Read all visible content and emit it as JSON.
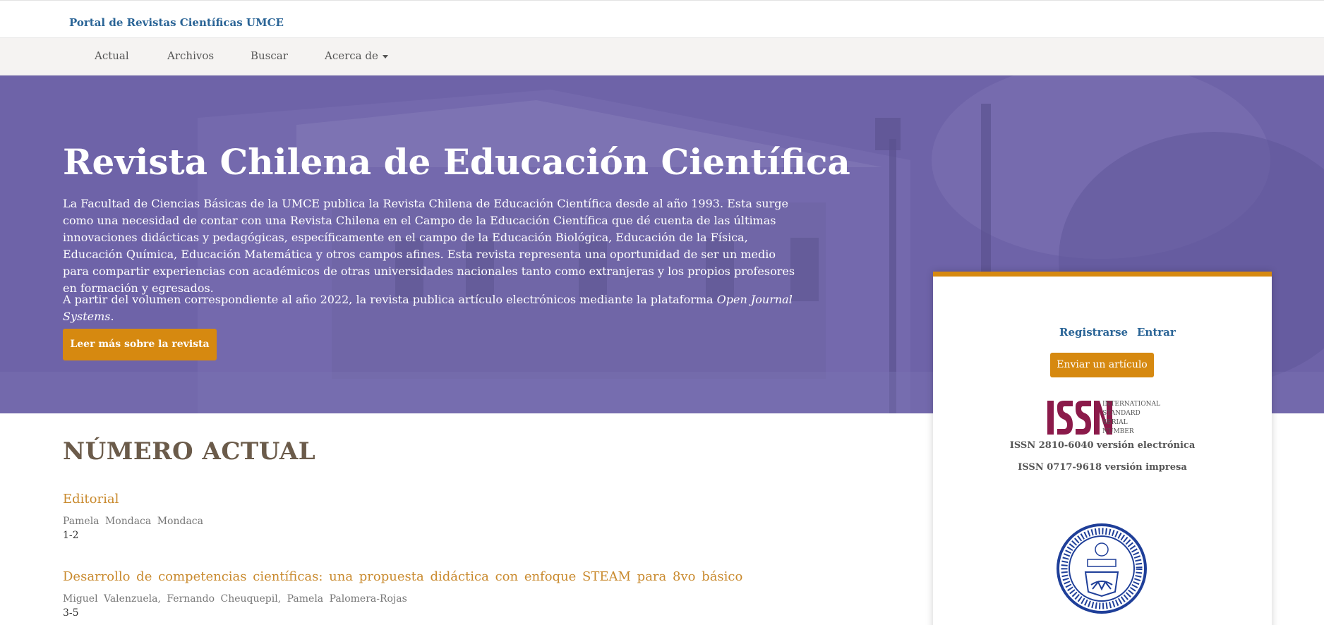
{
  "header": {
    "site_name": "Portal de Revistas Científicas UMCE"
  },
  "nav": {
    "items": [
      {
        "label": "Actual"
      },
      {
        "label": "Archivos"
      },
      {
        "label": "Buscar"
      },
      {
        "label": "Acerca de"
      }
    ]
  },
  "hero": {
    "title": "Revista Chilena de Educación Científica",
    "paragraph1": "La Facultad de Ciencias Básicas de la UMCE publica la Revista Chilena de Educación Científica desde al año 1993. Esta surge como una necesidad de contar con una Revista Chilena en el Campo de la Educación Científica que dé cuenta de las últimas innovaciones didácticas y pedagógicas, específicamente en el campo de la Educación Biológica, Educación de la Física, Educación Química, Educación Matemática y otros campos afines. Esta revista representa una oportunidad de ser un medio para compartir experiencias con académicos de otras universidades nacionales tanto como extranjeras y los propios profesores en formación y egresados.",
    "paragraph2_prefix": "A partir del volumen correspondiente al año 2022, la revista publica artículo electrónicos mediante la plataforma ",
    "paragraph2_platform": "Open Journal Systems",
    "paragraph2_suffix": ".",
    "button_label": "Leer más sobre la revista"
  },
  "sidebar": {
    "register_label": "Registrarse",
    "login_label": "Entrar",
    "submit_label": "Enviar un artículo",
    "issn_logo_text": [
      "INTERNATIONAL",
      "STANDARD",
      "SERIAL",
      "NUMBER"
    ],
    "issn_electronic": "ISSN 2810-6040 versión electrónica",
    "issn_print": "ISSN 0717-9618 versión impresa"
  },
  "current_issue": {
    "heading": "NÚMERO ACTUAL",
    "articles": [
      {
        "title": "Editorial",
        "authors": "Pamela Mondaca Mondaca",
        "pages": "1-2"
      },
      {
        "title": "Desarrollo de competencias científicas: una propuesta didáctica con enfoque STEAM para 8vo básico",
        "authors": "Miguel Valenzuela, Fernando Cheuquepil, Pamela Palomera-Rojas",
        "pages": "3-5"
      }
    ]
  },
  "colors": {
    "accent_orange": "#d68910",
    "link_blue": "#2a6496",
    "hero_purple": "#6b5da6",
    "issn_magenta": "#8b1a4a",
    "seal_blue": "#1f3f99"
  }
}
